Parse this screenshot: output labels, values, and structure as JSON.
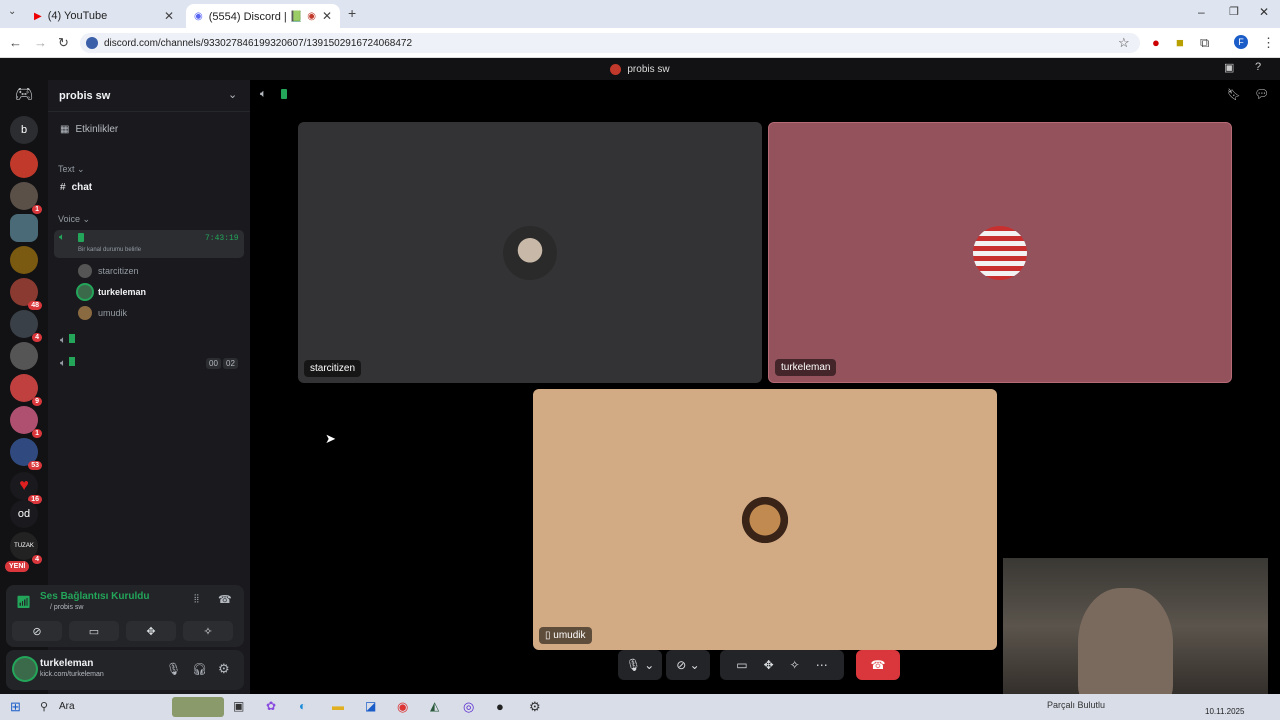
{
  "browser": {
    "tabs": [
      {
        "label": "(4) YouTube",
        "active": false
      },
      {
        "label": "(5554) Discord | 📗 | probis",
        "active": true
      }
    ],
    "url": "discord.com/channels/933027846199320607/1391502916724068472"
  },
  "discord": {
    "window_title": "probis sw",
    "server_name": "probis sw",
    "guild_letters": {
      "first": "b",
      "second": "od"
    },
    "guild_badges": [
      "1",
      "48",
      "4",
      "9",
      "1",
      "53",
      "16",
      "4"
    ],
    "new_badge": "YENİ",
    "events_label": "Etkinlikler",
    "text_category": "Text",
    "text_channel": "chat",
    "voice_category": "Voice",
    "voice_channel": {
      "timer": "7:43:19",
      "status": "Bir kanal durumu belirle",
      "users": [
        "starcitizen",
        "turkeleman",
        "umudik"
      ]
    },
    "other_channel_counts": [
      "00",
      "02"
    ],
    "voice_connection": {
      "title": "Ses Bağlantısı Kuruldu",
      "subtitle": "/ probis sw"
    },
    "user": {
      "name": "turkeleman",
      "status": "kick.com/turkeleman"
    },
    "tiles": [
      {
        "name": "starcitizen"
      },
      {
        "name": "turkeleman"
      },
      {
        "name": "umudik"
      }
    ]
  },
  "taskbar": {
    "search_label": "Ara",
    "clock_date": "10.11.2025",
    "media_label": "Parçalı Bulutlu"
  },
  "colors": {
    "accent_green": "#23a55a",
    "hangup_red": "#da373c",
    "tile1": "#333234",
    "tile2": "#94525d",
    "tile3": "#d2aa84"
  }
}
